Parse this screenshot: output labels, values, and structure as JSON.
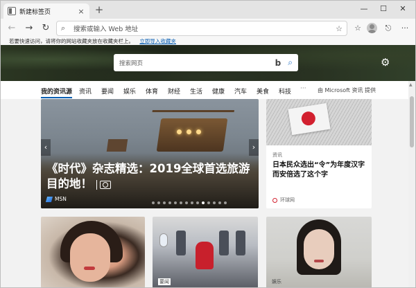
{
  "tab": {
    "title": "新建标签页",
    "close": "×",
    "new_tab": "+"
  },
  "window_controls": {
    "minimize": "—",
    "maximize": "☐",
    "close": "✕"
  },
  "toolbar": {
    "back": "←",
    "forward": "→",
    "refresh": "↻"
  },
  "omnibox": {
    "placeholder": "搜索或输入 Web 地址"
  },
  "favorites_bar": {
    "text": "若要快速访问，请将你的网站收藏夹放在收藏夹栏上。",
    "link": "立即导入收藏夹"
  },
  "hero": {
    "search_placeholder": "搜索网页"
  },
  "categories": [
    "我的资讯源",
    "资讯",
    "要闻",
    "娱乐",
    "体育",
    "财经",
    "生活",
    "健康",
    "汽车",
    "美食",
    "科技"
  ],
  "more": "···",
  "provider": "由 Microsoft 资讯 提供",
  "feature": {
    "title": "《时代》杂志精选：2019全球首选旅游目的地！",
    "source": "MSN",
    "dot_count": 14,
    "active_dot": 9
  },
  "side_card": {
    "category": "资讯",
    "title": "日本民众选出“令”为年度汉字 而安倍选了这个字",
    "source": "环球网"
  },
  "bottom_cards": [
    {
      "label": ""
    },
    {
      "label": "要闻"
    },
    {
      "label": "娱乐"
    }
  ],
  "colors": {
    "accent": "#0a5fb4",
    "hero_search_icon": "#2372c6",
    "flag_red": "#d2202f"
  }
}
